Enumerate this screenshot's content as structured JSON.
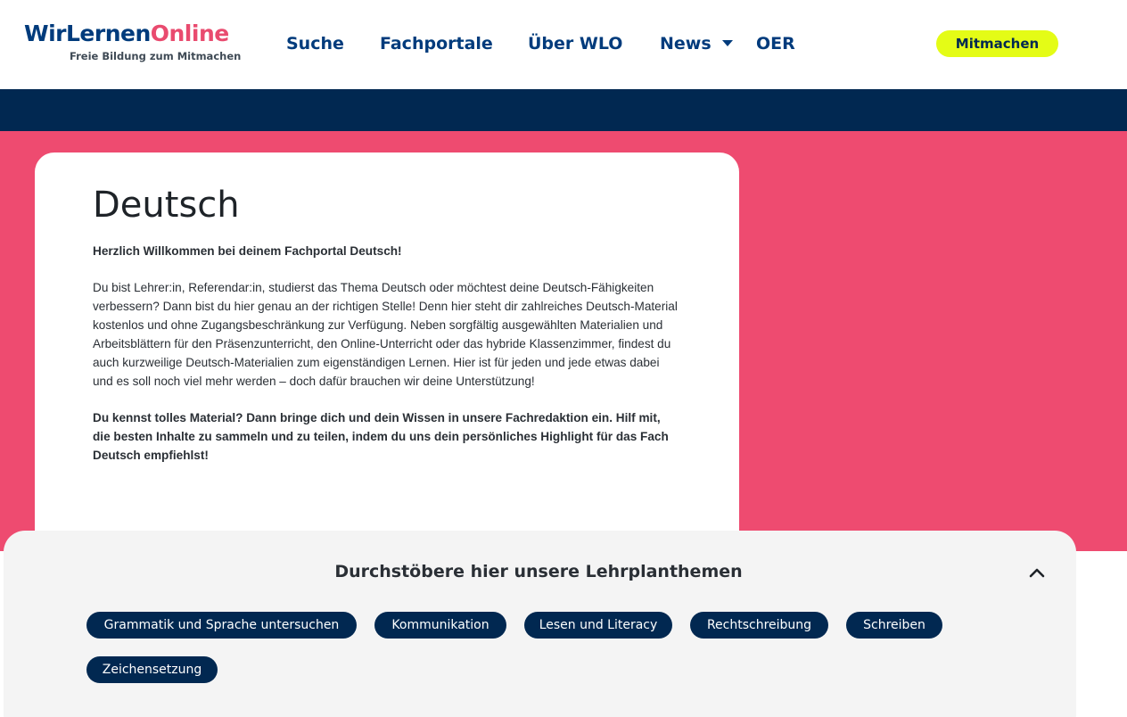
{
  "header": {
    "logo": {
      "name_part1": "WirLernen",
      "name_part2": "Online",
      "tagline": "Freie Bildung zum Mitmachen"
    },
    "nav": [
      {
        "label": "Suche"
      },
      {
        "label": "Fachportale"
      },
      {
        "label": "Über WLO"
      },
      {
        "label": "News",
        "has_dropdown": true
      },
      {
        "label": "OER"
      }
    ],
    "cta_label": "Mitmachen"
  },
  "intro": {
    "title": "Deutsch",
    "welcome": "Herzlich Willkommen bei deinem Fachportal Deutsch!",
    "body": "Du bist Lehrer:in, Referendar:in, studierst das Thema Deutsch oder möchtest deine Deutsch-Fähigkeiten verbessern? Dann bist du hier genau an der richtigen Stelle! Denn hier steht dir zahlreiches Deutsch-Material kostenlos und ohne Zugangsbeschränkung zur Verfügung. Neben sorgfältig ausgewählten Materialien und Arbeitsblättern für den Präsenzunterricht, den Online-Unterricht oder das hybride Klassenzimmer, findest du auch kurzweilige Deutsch-Materialien zum eigenständigen Lernen. Hier ist für jeden und jede etwas dabei und es soll noch viel mehr werden – doch dafür brauchen wir deine Unterstützung!",
    "call_to_action": "Du kennst tolles Material? Dann bringe dich und dein Wissen in unsere Fachredaktion ein. Hilf mit, die besten Inhalte zu sammeln und zu teilen, indem du uns dein persönliches Highlight für das Fach Deutsch empfiehlst!"
  },
  "topics": {
    "heading": "Durchstöbere hier unsere Lehrplanthemen",
    "collapse_icon": "chevron-up-icon",
    "items": [
      {
        "label": "Grammatik und Sprache untersuchen"
      },
      {
        "label": "Kommunikation"
      },
      {
        "label": "Lesen und Literacy"
      },
      {
        "label": "Rechtschreibung"
      },
      {
        "label": "Schreiben"
      },
      {
        "label": "Zeichensetzung"
      }
    ]
  },
  "colors": {
    "brand_navy": "#012851",
    "brand_blue": "#003b7c",
    "brand_pink": "#ee4b70",
    "accent_lime": "#e4fc16",
    "panel_gray": "#f4f4f4"
  }
}
